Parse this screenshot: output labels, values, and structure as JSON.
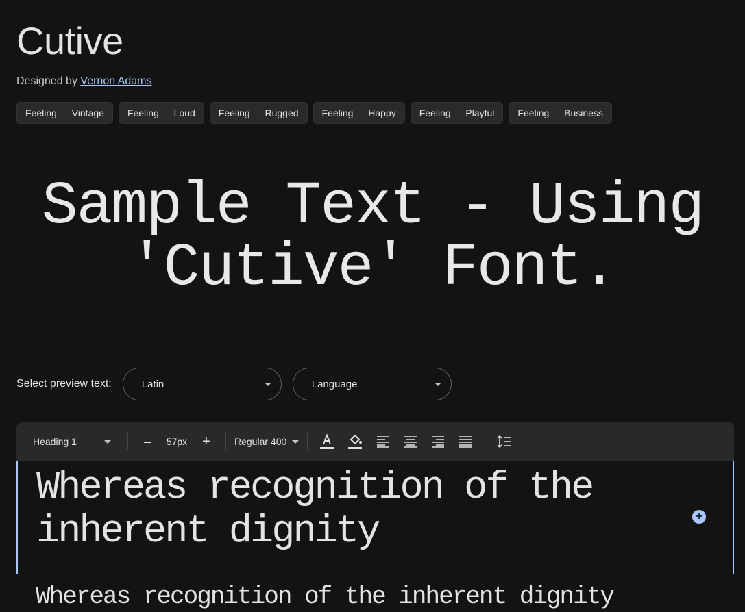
{
  "font": {
    "name": "Cutive",
    "designed_by_label": "Designed by",
    "designer": "Vernon Adams"
  },
  "tags": [
    "Feeling — Vintage",
    "Feeling — Loud",
    "Feeling — Rugged",
    "Feeling — Happy",
    "Feeling — Playful",
    "Feeling — Business"
  ],
  "hero_text": "Sample Text - Using 'Cutive' Font.",
  "preview": {
    "label": "Select preview text:",
    "script_value": "Latin",
    "language_value": "Language"
  },
  "toolbar": {
    "style_value": "Heading 1",
    "minus": "–",
    "size_value": "57px",
    "plus": "+",
    "weight_value": "Regular 400"
  },
  "editor": {
    "heading_text": "Whereas recognition of the inherent dignity",
    "add_button": "+",
    "second_text": "Whereas recognition of the inherent dignity"
  },
  "colors": {
    "background": "#131314",
    "accent": "#a8c7fa",
    "toolbar": "#28292a"
  }
}
